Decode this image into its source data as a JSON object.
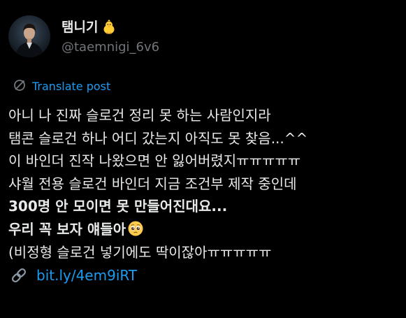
{
  "author": {
    "display_name": "탬니기",
    "handle": "@taemnigi_6v6"
  },
  "translate": {
    "label": "Translate post"
  },
  "post": {
    "lines": [
      "아니 나 진짜 슬로건 정리 못 하는 사람인지라",
      "탬콘 슬로건 하나 어디 갔는지 아직도 못 찾음...^^",
      "이 바인더 진작 나왔으면 안 잃어버렸지ㅠㅠㅠㅠㅠ",
      "샤월 전용 슬로건 바인더 지금 조건부 제작 중인데",
      "300명 안 모이면 못 만들어진대요...",
      "우리 꼭 보자 얘들아",
      "(비정형 슬로건 넣기에도 딱이잖아ㅠㅠㅠㅠㅠ"
    ],
    "link": "bit.ly/4em9iRT"
  },
  "colors": {
    "background": "#000000",
    "text": "#e7e9ea",
    "muted": "#71767b",
    "accent": "#1d9bf0"
  },
  "icons": {
    "display_name_emoji": "baby-chick-icon",
    "line_emoji": "pleading-face-icon",
    "translate": "translate-icon",
    "link": "link-icon"
  }
}
